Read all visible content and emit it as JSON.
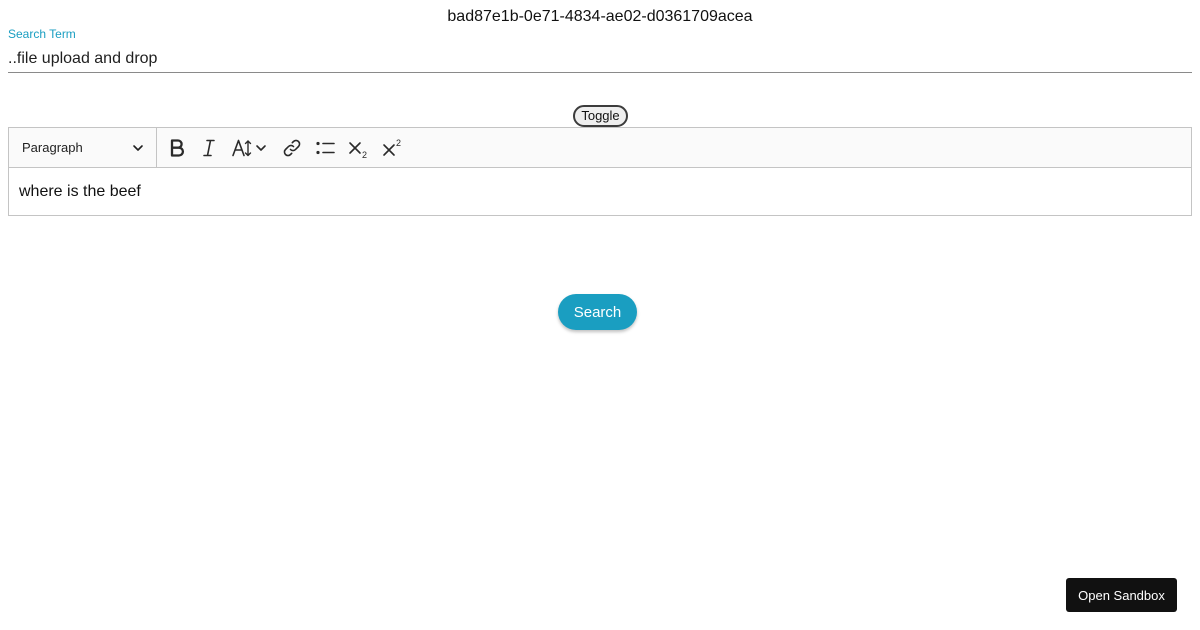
{
  "header": {
    "id_text": "bad87e1b-0e71-4834-ae02-d0361709acea"
  },
  "search": {
    "label": "Search Term",
    "value": "..file upload and drop"
  },
  "toggle": {
    "label": "Toggle"
  },
  "editor": {
    "block_type": "Paragraph",
    "content": "where is the beef",
    "toolbar": [
      {
        "icon": "bold-icon"
      },
      {
        "icon": "italic-icon"
      },
      {
        "icon": "font-size-icon"
      },
      {
        "icon": "link-icon"
      },
      {
        "icon": "bulleted-list-icon"
      },
      {
        "icon": "subscript-icon"
      },
      {
        "icon": "superscript-icon"
      }
    ]
  },
  "actions": {
    "search_label": "Search",
    "sandbox_label": "Open Sandbox"
  },
  "colors": {
    "accent": "#1a9ec1",
    "sandbox_button": "#111111"
  }
}
